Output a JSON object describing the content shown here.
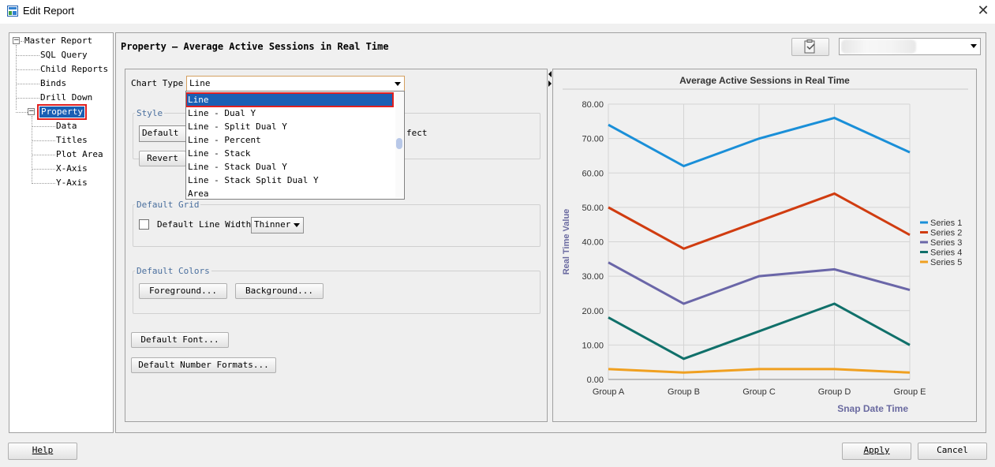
{
  "window": {
    "title": "Edit Report",
    "close_glyph": "✕"
  },
  "tree": {
    "items": [
      {
        "label": "Master Report"
      },
      {
        "label": "SQL Query"
      },
      {
        "label": "Child Reports"
      },
      {
        "label": "Binds"
      },
      {
        "label": "Drill Down"
      },
      {
        "label": "Property"
      },
      {
        "label": "Data"
      },
      {
        "label": "Titles"
      },
      {
        "label": "Plot Area"
      },
      {
        "label": "X-Axis"
      },
      {
        "label": "Y-Axis"
      }
    ]
  },
  "header": {
    "title": "Property – Average Active Sessions in Real Time"
  },
  "property": {
    "chart_type_label": "Chart Type",
    "chart_type_value": "Line",
    "chart_type_options": [
      "Line",
      "Line - Dual Y",
      "Line - Split Dual Y",
      "Line - Percent",
      "Line - Stack",
      "Line - Stack Dual Y",
      "Line - Stack Split Dual Y",
      "Area"
    ],
    "style_group_label": "Style",
    "style_value": "Default",
    "effect_partial": "fect",
    "revert_label": "Revert",
    "default_grid_label": "Default Grid",
    "default_line_width_label": "Default Line Width",
    "line_width_value": "Thinner",
    "default_colors_label": "Default Colors",
    "foreground_label": "Foreground...",
    "background_label": "Background...",
    "default_font_label": "Default Font...",
    "default_number_formats_label": "Default Number Formats..."
  },
  "footer": {
    "help_label": "Help",
    "apply_label": "Apply",
    "cancel_label": "Cancel"
  },
  "chart_data": {
    "type": "line",
    "title": "Average Active Sessions in Real Time",
    "xlabel": "Snap Date Time",
    "ylabel": "Real Time Value",
    "categories": [
      "Group A",
      "Group B",
      "Group C",
      "Group D",
      "Group E"
    ],
    "ylim": [
      0,
      80
    ],
    "yticks": [
      "0.00",
      "10.00",
      "20.00",
      "30.00",
      "40.00",
      "50.00",
      "60.00",
      "70.00",
      "80.00"
    ],
    "grid": true,
    "legend": "right",
    "series": [
      {
        "name": "Series 1",
        "color": "#1a8fd8",
        "values": [
          74,
          62,
          70,
          76,
          66
        ]
      },
      {
        "name": "Series 2",
        "color": "#d03c10",
        "values": [
          50,
          38,
          46,
          54,
          42
        ]
      },
      {
        "name": "Series 3",
        "color": "#6a66a8",
        "values": [
          34,
          22,
          30,
          32,
          26
        ]
      },
      {
        "name": "Series 4",
        "color": "#10706a",
        "values": [
          18,
          6,
          14,
          22,
          10
        ]
      },
      {
        "name": "Series 5",
        "color": "#f0a020",
        "values": [
          3,
          2,
          3,
          3,
          2
        ]
      }
    ]
  }
}
